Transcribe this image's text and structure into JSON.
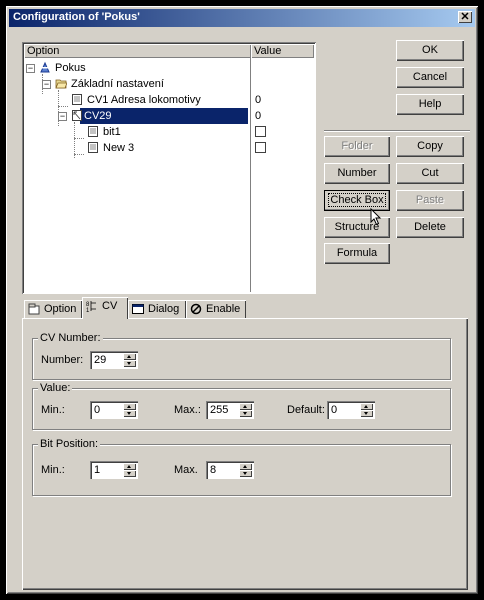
{
  "window": {
    "title": "Configuration of 'Pokus'",
    "close_label": "✕"
  },
  "tree": {
    "headers": {
      "option": "Option",
      "value": "Value"
    },
    "rows": [
      {
        "label": "Pokus",
        "value": ""
      },
      {
        "label": "Základní nastavení",
        "value": ""
      },
      {
        "label": "CV1 Adresa lokomotivy",
        "value": "0"
      },
      {
        "label": "CV29",
        "value": "0"
      },
      {
        "label": "bit1",
        "value": ""
      },
      {
        "label": "New 3",
        "value": ""
      }
    ]
  },
  "buttons": {
    "ok": "OK",
    "cancel": "Cancel",
    "help": "Help",
    "folder": "Folder",
    "copy": "Copy",
    "number": "Number",
    "cut": "Cut",
    "checkbox": "Check Box",
    "paste": "Paste",
    "structure": "Structure",
    "delete": "Delete",
    "formula": "Formula"
  },
  "tabs": [
    {
      "label": "Option",
      "icon": "option-icon"
    },
    {
      "label": "CV",
      "icon": "cv-icon"
    },
    {
      "label": "Dialog",
      "icon": "dialog-icon"
    },
    {
      "label": "Enable",
      "icon": "enable-icon"
    }
  ],
  "cv_number": {
    "title": "CV Number:",
    "number_label": "Number:",
    "number_value": "29"
  },
  "value_group": {
    "title": "Value:",
    "min_label": "Min.:",
    "min_value": "0",
    "max_label": "Max.:",
    "max_value": "255",
    "default_label": "Default:",
    "default_value": "0"
  },
  "bit_position": {
    "title": "Bit Position:",
    "min_label": "Min.:",
    "min_value": "1",
    "max_label": "Max.",
    "max_value": "8"
  },
  "colors": {
    "titlebar": "#0a246a",
    "selection": "#0a246a",
    "face": "#d4d0c8"
  }
}
